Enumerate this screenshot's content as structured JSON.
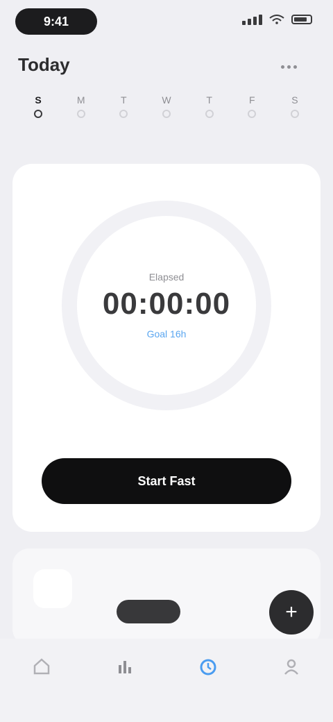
{
  "status_bar": {
    "time": "9:41"
  },
  "header": {
    "title": "Today"
  },
  "week": {
    "days": [
      {
        "letter": "S",
        "today": true
      },
      {
        "letter": "M",
        "today": false
      },
      {
        "letter": "T",
        "today": false
      },
      {
        "letter": "W",
        "today": false
      },
      {
        "letter": "T",
        "today": false
      },
      {
        "letter": "F",
        "today": false
      },
      {
        "letter": "S",
        "today": false
      }
    ]
  },
  "fast_card": {
    "elapsed_label": "Elapsed",
    "elapsed_time": "00:00:00",
    "goal_text": "Goal 16h",
    "start_label": "Start Fast",
    "progress_fraction": 0
  },
  "info_card": {
    "title": "",
    "chip_label": ""
  },
  "fab": {
    "label": "+"
  },
  "tab_bar": {
    "tabs": [
      {
        "label": "",
        "icon": "home-icon",
        "active": false
      },
      {
        "label": "",
        "icon": "stats-icon",
        "active": false
      },
      {
        "label": "",
        "icon": "timer-icon",
        "active": true
      },
      {
        "label": "",
        "icon": "profile-icon",
        "active": false
      }
    ]
  },
  "colors": {
    "accent": "#4a9cf0",
    "background": "#efeff3",
    "button": "#0f0f10"
  }
}
